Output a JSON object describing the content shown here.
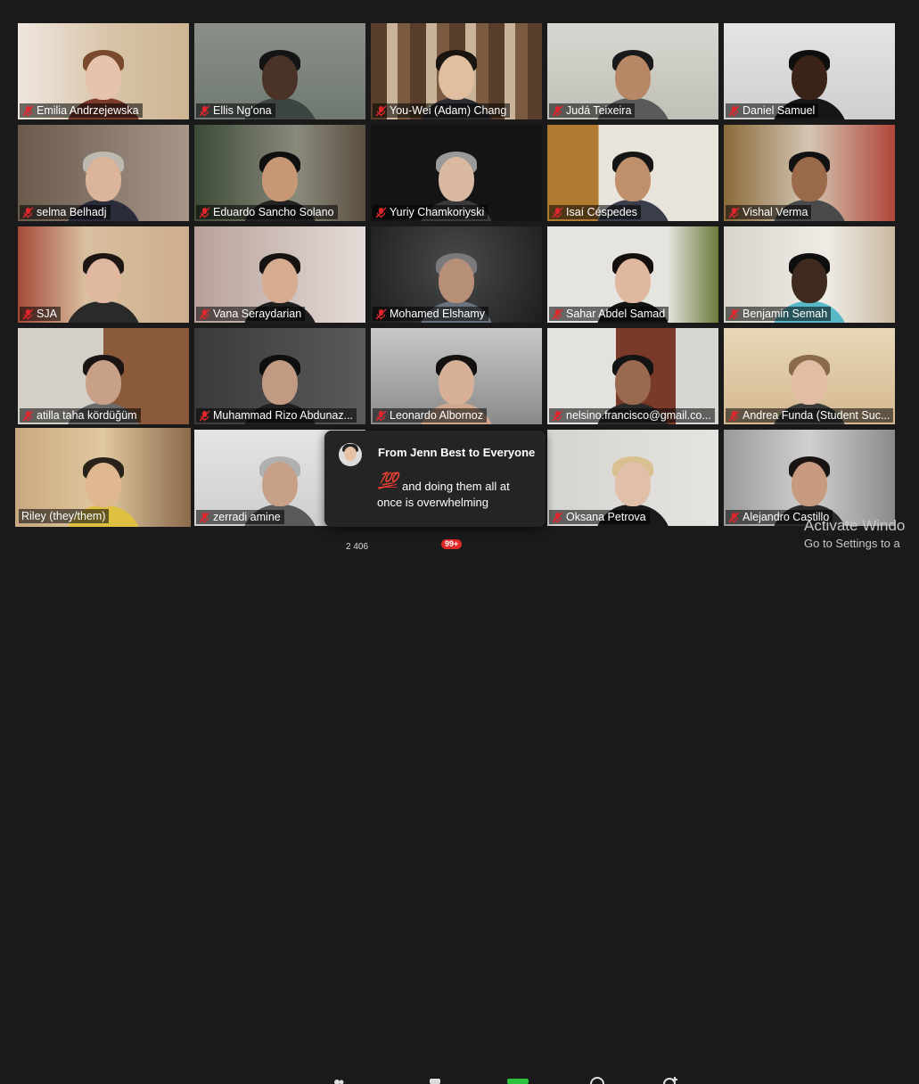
{
  "participants": [
    {
      "name": "Emilia Andrzejewska"
    },
    {
      "name": "Ellis Ng'ona"
    },
    {
      "name": "You-Wei (Adam) Chang"
    },
    {
      "name": "Judá Teixeira"
    },
    {
      "name": "Daniel Samuel"
    },
    {
      "name": "selma Belhadj"
    },
    {
      "name": "Eduardo Sancho Solano"
    },
    {
      "name": "Yuriy Chamkoriyski"
    },
    {
      "name": "Isaí Céspedes"
    },
    {
      "name": "Vishal Verma"
    },
    {
      "name": "SJA"
    },
    {
      "name": "Vana Seraydarian"
    },
    {
      "name": "Mohamed Elshamy"
    },
    {
      "name": "Sahar Abdel Samad"
    },
    {
      "name": "Benjamin Semah"
    },
    {
      "name": "atilla taha kördüğüm"
    },
    {
      "name": "Muhammad Rizo Abdunaz..."
    },
    {
      "name": "Leonardo Albornoz"
    },
    {
      "name": "nelsino.francisco@gmail.co..."
    },
    {
      "name": "Andrea Funda (Student Suc..."
    },
    {
      "name": "Riley (they/them)"
    },
    {
      "name": "zerradi amine"
    },
    {
      "name": "Oksana Petrova"
    },
    {
      "name": "Alejandro Castillo"
    }
  ],
  "chat_notification": {
    "title": "From Jenn Best to Everyone",
    "emoji": "💯",
    "message": "and doing them all at once is overwhelming"
  },
  "toolbar": {
    "participants_count": "2 406",
    "chat_badge": "99+"
  },
  "watermark": {
    "line1": "Activate Windo",
    "line2": "Go to Settings to a"
  },
  "colors": {
    "active_speaker_border": "#e3e364",
    "muted_icon": "#e0262c",
    "chat_badge": "#e02828"
  }
}
